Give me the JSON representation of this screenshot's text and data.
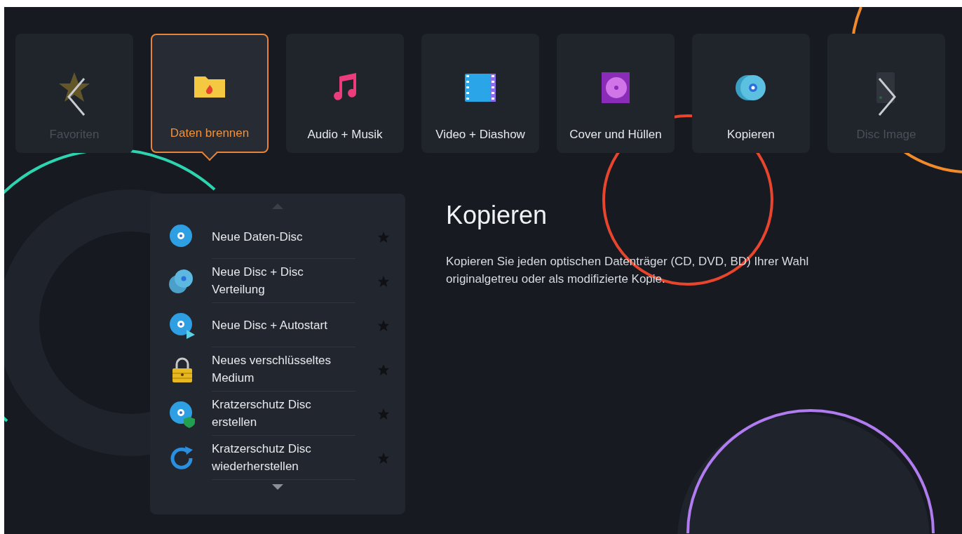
{
  "categories": [
    {
      "label": "Favoriten",
      "kind": "star",
      "selected": false,
      "faded": true
    },
    {
      "label": "Daten brennen",
      "kind": "folder-fire",
      "selected": true,
      "faded": false
    },
    {
      "label": "Audio + Musik",
      "kind": "music",
      "selected": false,
      "faded": false
    },
    {
      "label": "Video + Diashow",
      "kind": "film",
      "selected": false,
      "faded": false
    },
    {
      "label": "Cover und Hüllen",
      "kind": "disc-case",
      "selected": false,
      "faded": false
    },
    {
      "label": "Kopieren",
      "kind": "discs",
      "selected": false,
      "faded": false
    },
    {
      "label": "Disc Image",
      "kind": "drive",
      "selected": false,
      "faded": true
    }
  ],
  "menu": [
    {
      "label": "Neue Daten-Disc",
      "kind": "disc",
      "favorite": false
    },
    {
      "label": "Neue Disc + Disc Verteilung",
      "kind": "disc-stack",
      "favorite": false
    },
    {
      "label": "Neue Disc + Autostart",
      "kind": "disc-play",
      "favorite": false
    },
    {
      "label": "Neues verschlüsseltes Medium",
      "kind": "lock",
      "favorite": false
    },
    {
      "label": "Kratzerschutz Disc erstellen",
      "kind": "disc-shield",
      "favorite": false
    },
    {
      "label": "Kratzerschutz Disc wiederherstellen",
      "kind": "restore",
      "favorite": false
    }
  ],
  "detail": {
    "title": "Kopieren",
    "description": "Kopieren Sie jeden optischen Datenträger (CD, DVD, BD) Ihrer Wahl originalgetreu oder als modifizierte Kopie."
  }
}
